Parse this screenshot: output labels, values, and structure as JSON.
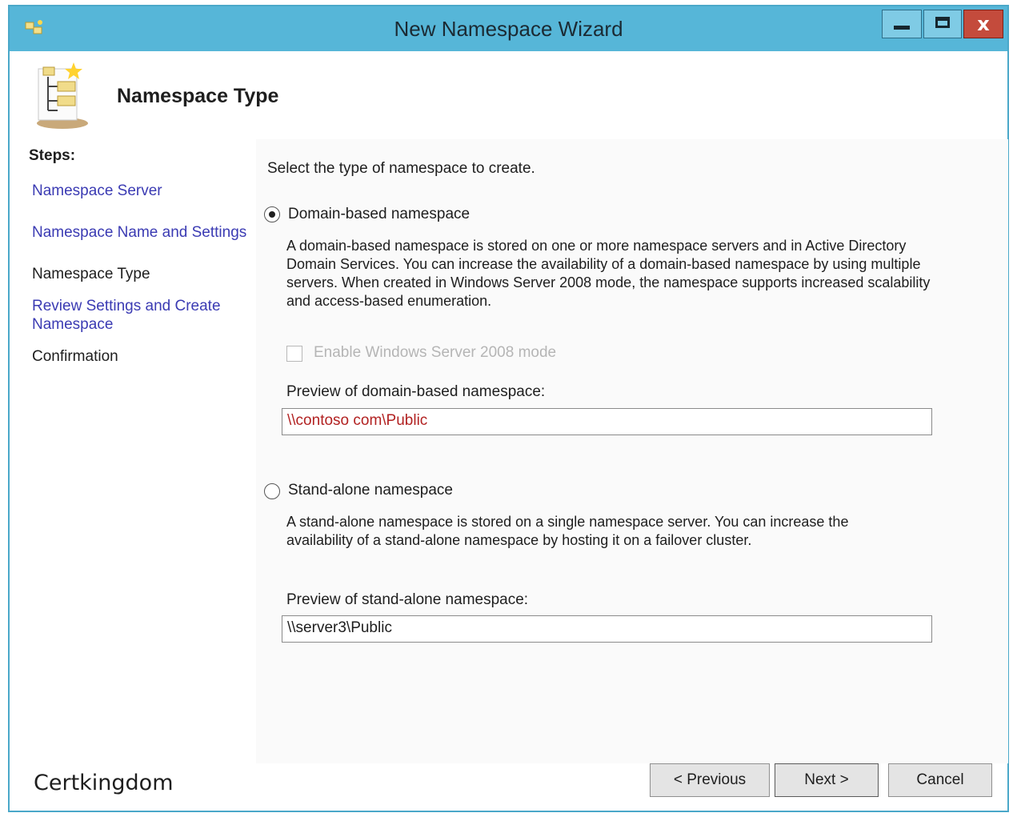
{
  "window": {
    "title": "New Namespace Wizard",
    "close_glyph": "x",
    "app_icon": "namespace-icon",
    "colors": {
      "titlebar": "#56b6d8",
      "close": "#c44b3c",
      "link": "#3b3bb3",
      "preview_text": "#b22222"
    }
  },
  "header": {
    "title": "Namespace Type"
  },
  "steps": {
    "heading": "Steps:",
    "items": [
      {
        "label": "Namespace Server",
        "state": "link"
      },
      {
        "label": "Namespace Name and Settings",
        "state": "link"
      },
      {
        "label": "Namespace Type",
        "state": "current"
      },
      {
        "label": "Review Settings and Create Namespace",
        "state": "link"
      },
      {
        "label": "Confirmation",
        "state": "plain"
      }
    ]
  },
  "content": {
    "intro": "Select the type of namespace to create.",
    "domain_option": {
      "label": "Domain-based namespace",
      "selected": true,
      "description": "A domain-based namespace is stored on one or more namespace servers and in Active Directory Domain Services. You can increase the availability of a domain-based namespace by using multiple servers. When created in Windows Server 2008 mode, the namespace supports increased scalability and access-based enumeration.",
      "checkbox_label": "Enable Windows Server 2008 mode",
      "checkbox_checked": false,
      "checkbox_enabled": false,
      "preview_label": "Preview of domain-based namespace:",
      "preview_value": "\\\\contoso com\\Public"
    },
    "standalone_option": {
      "label": "Stand-alone namespace",
      "selected": false,
      "description": "A stand-alone namespace is stored on a single namespace server. You can increase the availability of a stand-alone namespace by hosting it on a failover cluster.",
      "preview_label": "Preview of stand-alone namespace:",
      "preview_value": "\\\\server3\\Public"
    }
  },
  "footer": {
    "watermark": "Certkingdom",
    "previous_label": "< Previous",
    "next_label": "Next >",
    "cancel_label": "Cancel"
  }
}
